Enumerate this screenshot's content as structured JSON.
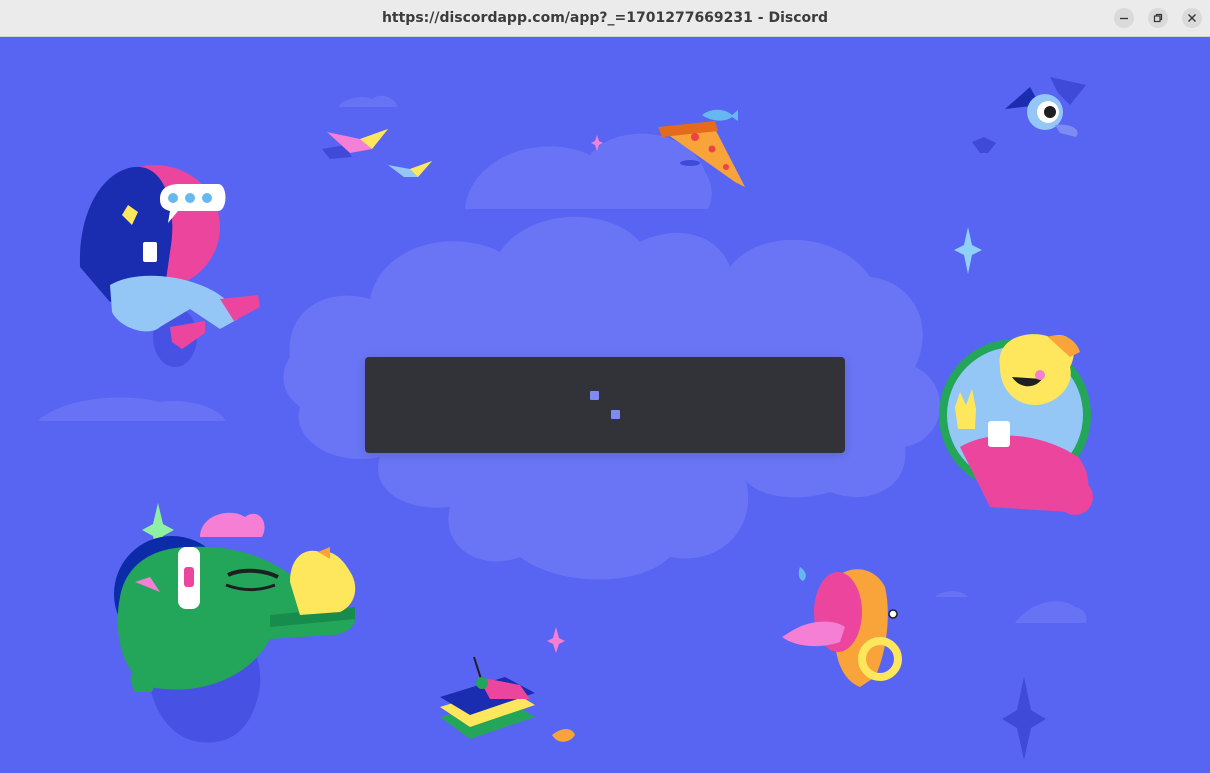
{
  "window": {
    "title": "https://discordapp.com/app?_=1701277669231 - Discord",
    "buttons": [
      "minimize-icon",
      "restore-icon",
      "close-icon"
    ]
  },
  "loading": {
    "state": "loading",
    "spinner": "two-square-spinner"
  },
  "colors": {
    "background": "#5865f2",
    "cloud": "#6a75f5",
    "loader_card": "#313338",
    "spinner": "#7f8bf5"
  },
  "illustrations": [
    "hooded-character-with-phone",
    "flying-books",
    "pizza-slice-with-fish",
    "bat-eyeball-creature",
    "yellow-character-waving-in-portal",
    "green-crocodile-with-headphones",
    "rubber-duck",
    "gramophone-horn-with-tongue",
    "sandwich-with-antenna",
    "sparkles"
  ]
}
